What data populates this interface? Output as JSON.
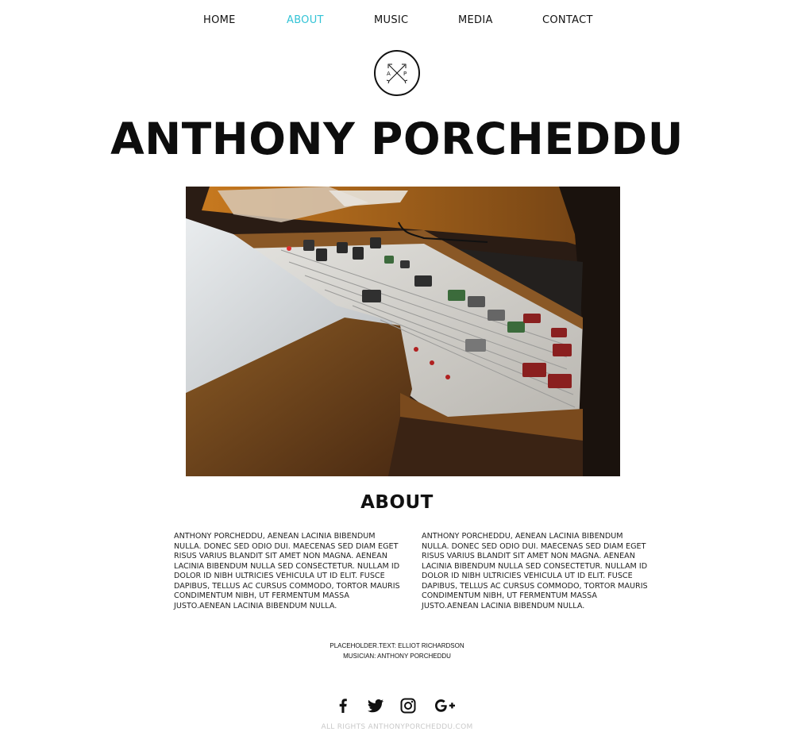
{
  "nav": {
    "items": [
      {
        "label": "HOME",
        "active": false
      },
      {
        "label": "ABOUT",
        "active": true
      },
      {
        "label": "MUSIC",
        "active": false
      },
      {
        "label": "MEDIA",
        "active": false
      },
      {
        "label": "CONTACT",
        "active": false
      }
    ],
    "active_color": "#33c3d6"
  },
  "logo": {
    "left_letter": "A",
    "right_letter": "P",
    "icon": "crossed-arrows-monogram-icon"
  },
  "site_title": "ANTHONY PORCHEDDU",
  "hero_image": {
    "subject": "mixing-console-photo"
  },
  "about": {
    "title": "ABOUT",
    "paragraph_left": "ANTHONY PORCHEDDU, AENEAN LACINIA BIBENDUM NULLA. DONEC SED ODIO DUI. MAECENAS SED DIAM EGET RISUS VARIUS BLANDIT SIT AMET NON MAGNA. AENEAN LACINIA BIBENDUM NULLA SED CONSECTETUR. NULLAM ID DOLOR ID NIBH ULTRICIES VEHICULA UT ID ELIT. FUSCE DAPIBUS, TELLUS AC CURSUS COMMODO, TORTOR MAURIS CONDIMENTUM NIBH, UT FERMENTUM MASSA JUSTO.AENEAN LACINIA BIBENDUM NULLA.",
    "paragraph_right": "ANTHONY PORCHEDDU, AENEAN LACINIA BIBENDUM NULLA. DONEC SED ODIO DUI. MAECENAS SED DIAM EGET RISUS VARIUS BLANDIT SIT AMET NON MAGNA. AENEAN LACINIA BIBENDUM NULLA SED CONSECTETUR. NULLAM ID DOLOR ID NIBH ULTRICIES VEHICULA UT ID ELIT. FUSCE DAPIBUS, TELLUS AC CURSUS COMMODO, TORTOR MAURIS CONDIMENTUM NIBH, UT FERMENTUM MASSA JUSTO.AENEAN LACINIA BIBENDUM NULLA."
  },
  "credits": {
    "line1": "PLACEHOLDER.TEXT: ELLIOT RICHARDSON",
    "line2": "MUSICIAN: ANTHONY PORCHEDDU"
  },
  "social": [
    {
      "icon": "facebook-icon"
    },
    {
      "icon": "twitter-icon"
    },
    {
      "icon": "instagram-icon"
    },
    {
      "icon": "google-plus-icon"
    }
  ],
  "footer": {
    "copyright": "ALL RIGHTS ANTHONYPORCHEDDU.COM"
  }
}
